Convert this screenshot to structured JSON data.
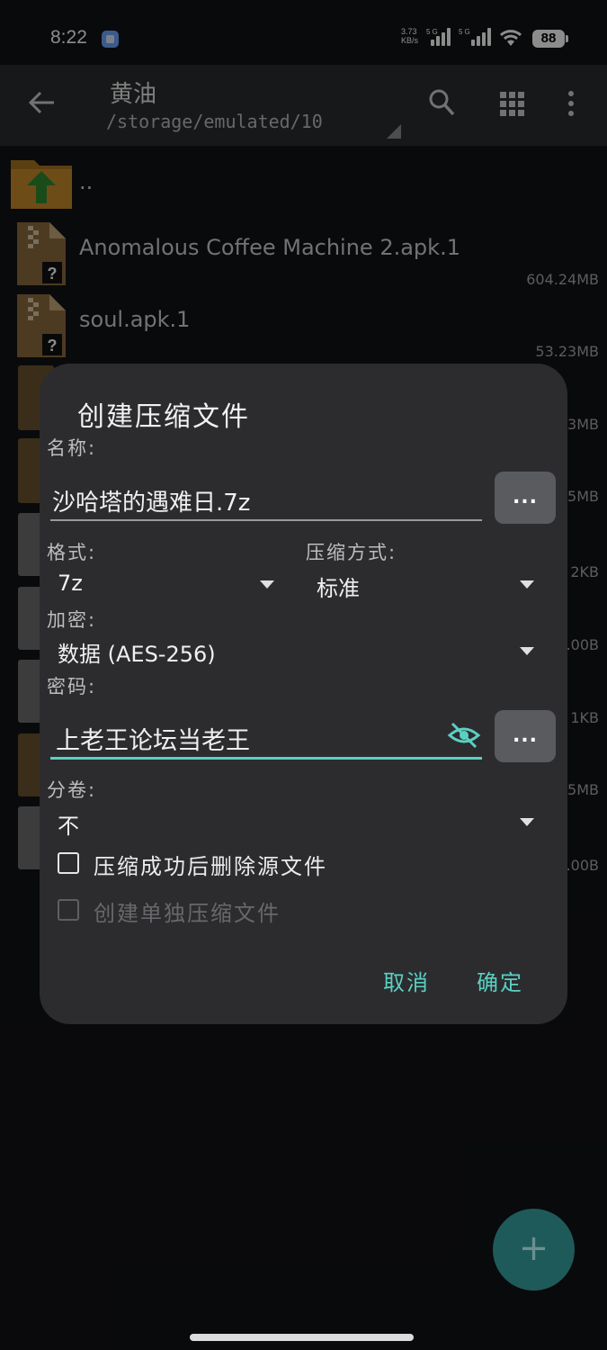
{
  "status_bar": {
    "time": "8:22",
    "net_speed_value": "3.73",
    "net_speed_unit": "KB/s",
    "sim1": "5G",
    "sim2": "5G",
    "battery": "88"
  },
  "toolbar": {
    "title": "黄油",
    "path": "/storage/emulated/10"
  },
  "files": [
    {
      "name": "..",
      "size": ""
    },
    {
      "name": "Anomalous Coffee Machine 2.apk.1",
      "size": "604.24MB"
    },
    {
      "name": "soul.apk.1",
      "size": "53.23MB"
    }
  ],
  "background_fragments": [
    "3MB",
    "5MB",
    "2KB",
    ".00B",
    "1KB",
    "5MB",
    ".00B"
  ],
  "dialog": {
    "title": "创建压缩文件",
    "name_label": "名称:",
    "name_value": "沙哈塔的遇难日.7z",
    "browse_button": "...",
    "format_label": "格式:",
    "format_value": "7z",
    "method_label": "压缩方式:",
    "method_value": "标准",
    "encryption_label": "加密:",
    "encryption_value": "数据 (AES-256)",
    "password_label": "密码:",
    "password_value": "上老王论坛当老王",
    "password_button": "...",
    "volume_label": "分卷:",
    "volume_value": "不",
    "delete_source_label": "压缩成功后删除源文件",
    "separate_archive_label": "创建单独压缩文件",
    "cancel": "取消",
    "ok": "确定"
  },
  "colors": {
    "accent": "#5bd0c2",
    "dialog_bg": "#2c2c2f",
    "folder": "#c98b2a",
    "fab": "#1f5a5a"
  }
}
